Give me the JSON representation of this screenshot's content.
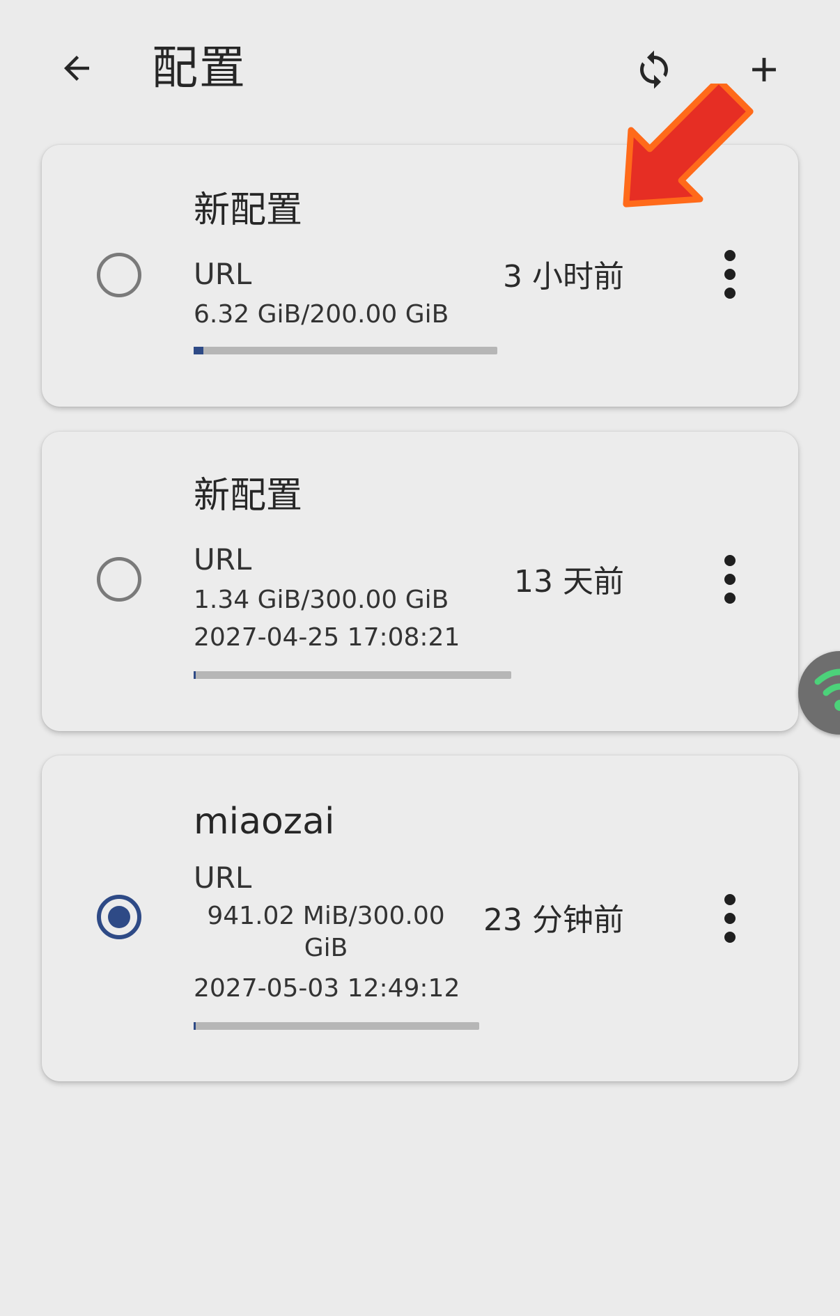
{
  "header": {
    "title": "配置",
    "icons": {
      "back": "arrow-left-icon",
      "refresh": "refresh-icon",
      "add": "plus-icon"
    }
  },
  "annotation": {
    "arrow_color": "#e62e24",
    "points_to": "add-button"
  },
  "profiles": [
    {
      "name": "新配置",
      "type": "URL",
      "usage": "6.32 GiB/200.00 GiB",
      "expire": "",
      "updated": "3 小时前",
      "selected": false,
      "usage_fraction": 0.032
    },
    {
      "name": "新配置",
      "type": "URL",
      "usage": "1.34 GiB/300.00 GiB",
      "expire": "2027-04-25 17:08:21",
      "updated": "13 天前",
      "selected": false,
      "usage_fraction": 0.0045
    },
    {
      "name": "miaozai",
      "type": "URL",
      "usage": "941.02 MiB/300.00 GiB",
      "expire": "2027-05-03 12:49:12",
      "updated": "23 分钟前",
      "selected": true,
      "usage_fraction": 0.003
    }
  ],
  "floating_button": {
    "icon": "wifi-icon",
    "color": "#4cd27a"
  },
  "colors": {
    "accent": "#2e4a86",
    "background": "#ebebeb",
    "card": "#ececec",
    "track": "#b6b6b6"
  }
}
